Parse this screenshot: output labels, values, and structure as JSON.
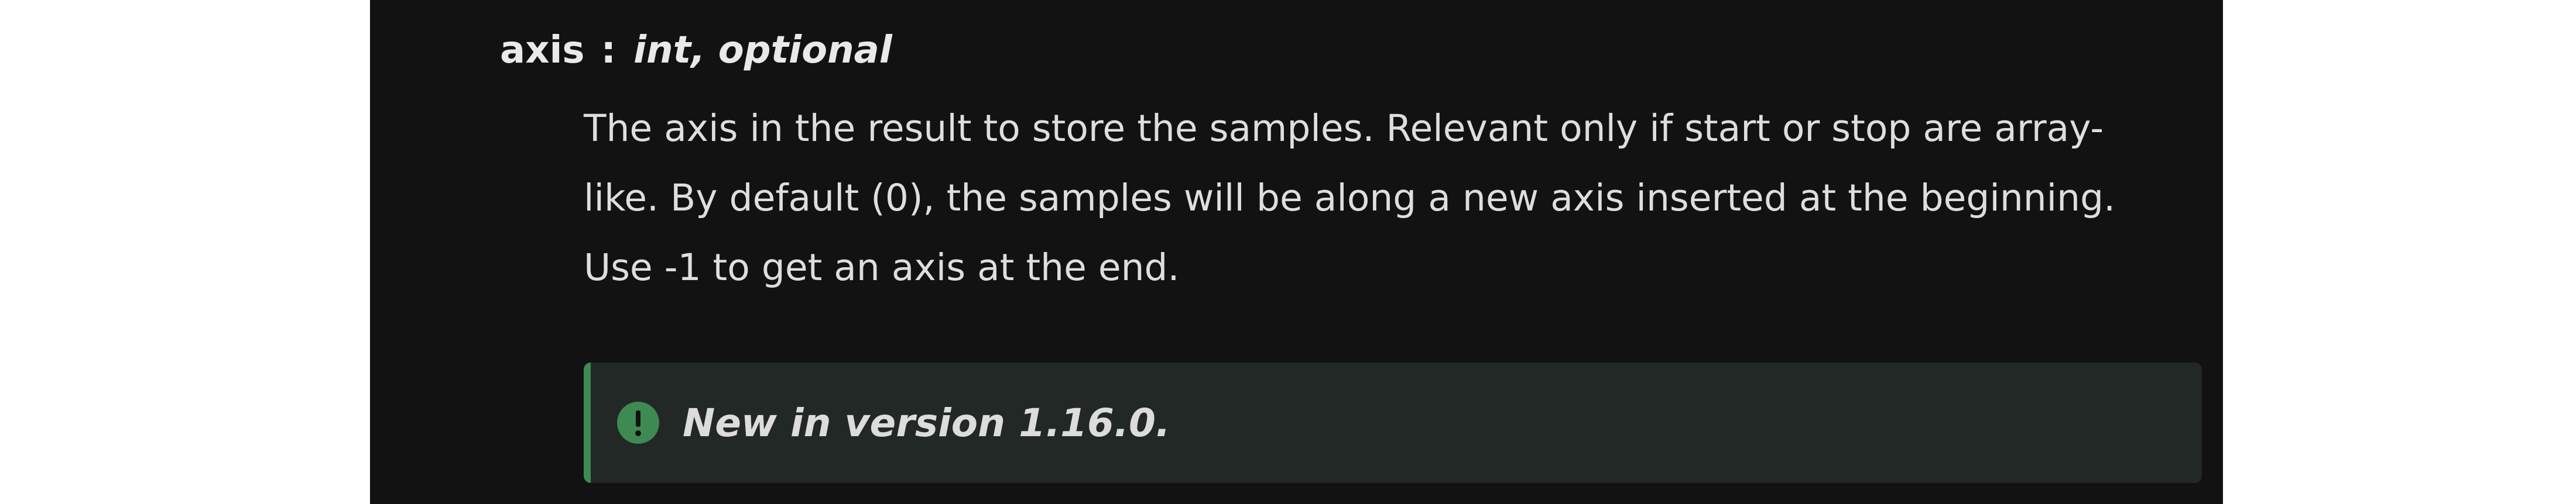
{
  "param": {
    "name": "axis",
    "separator": ":",
    "type": "int, optional"
  },
  "description": {
    "lines": [
      "The axis in the result to store the samples. Relevant only if start or stop are array-",
      "like. By default (0), the samples will be along a new axis inserted at the beginning.",
      "Use -1 to get an axis at the end."
    ]
  },
  "version_note": {
    "icon": "exclamation-circle-icon",
    "text": "New in version 1.16.0.",
    "accent_color": "#3f8a52"
  },
  "colors": {
    "background": "#121212",
    "text": "#dedede",
    "note_background": "#222825"
  }
}
